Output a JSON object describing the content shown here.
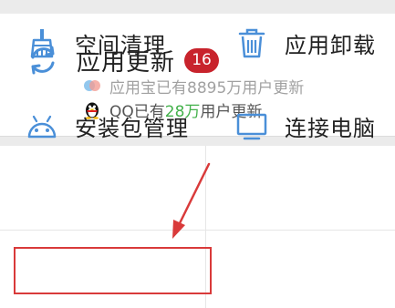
{
  "update_card": {
    "title": "应用更新",
    "badge_count": "16",
    "ticker_prev": "应用宝已有8895万用户更新",
    "ticker_prefix": "QQ已有",
    "ticker_highlight": "28万",
    "ticker_suffix": "用户更新"
  },
  "tools": [
    {
      "label": "空间清理",
      "icon": "broom-icon"
    },
    {
      "label": "应用卸载",
      "icon": "trash-icon"
    },
    {
      "label": "安装包管理",
      "icon": "android-icon"
    },
    {
      "label": "连接电脑",
      "icon": "monitor-icon"
    }
  ],
  "colors": {
    "accent_blue": "#4a8fd8",
    "badge_red": "#c8232c",
    "highlight_green": "#43b14b",
    "annotation_red": "#d93a3a"
  }
}
